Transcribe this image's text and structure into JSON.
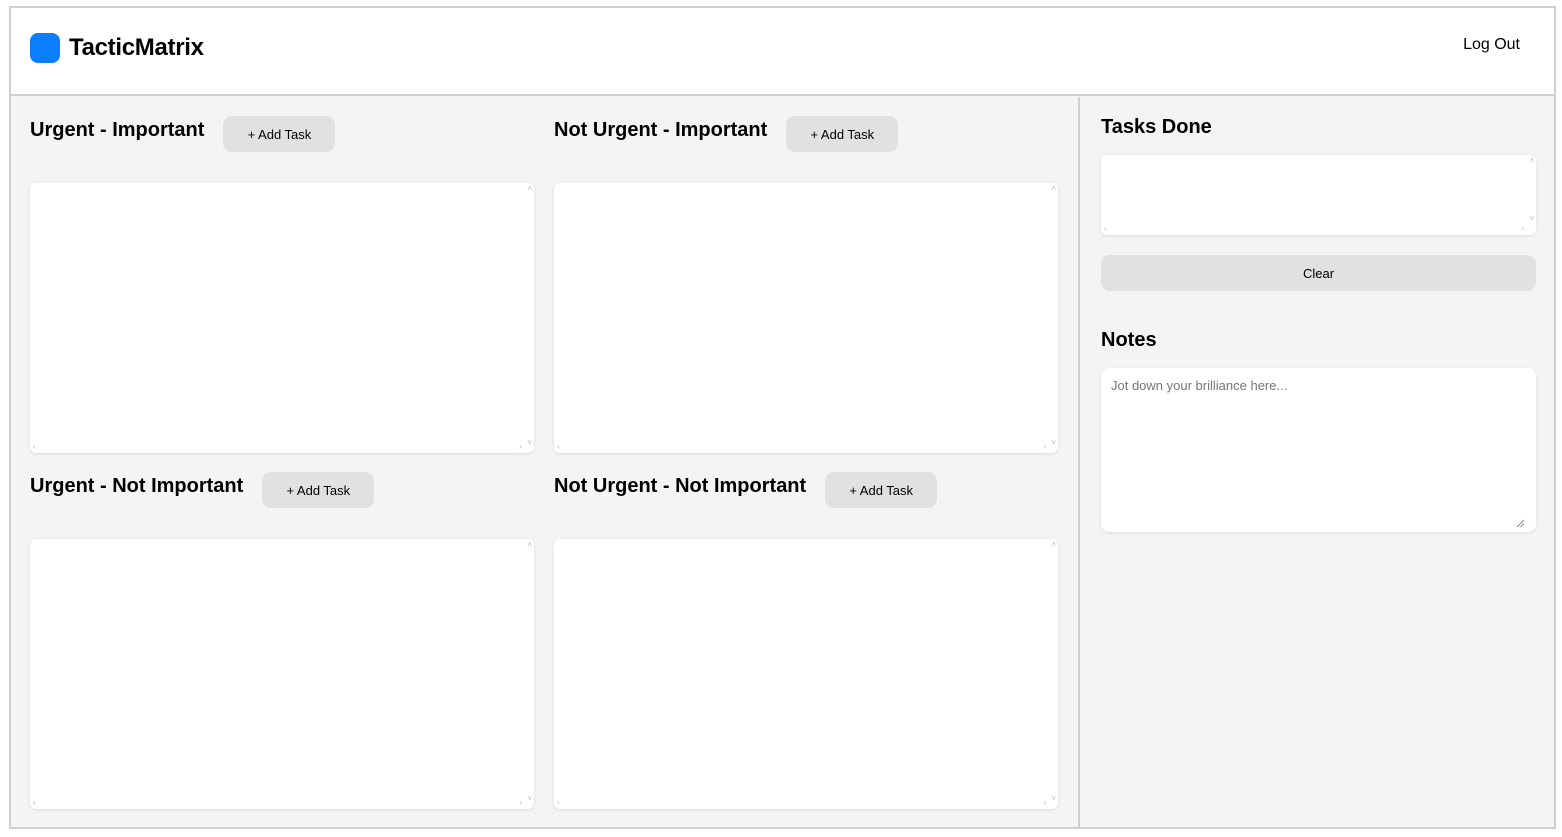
{
  "header": {
    "app_title": "TacticMatrix",
    "logout_label": "Log Out",
    "logo_color": "#0b7dff"
  },
  "quadrants": [
    {
      "title": "Urgent - Important",
      "add_label": "+ Add Task"
    },
    {
      "title": "Not Urgent - Important",
      "add_label": "+ Add Task"
    },
    {
      "title": "Urgent - Not Important",
      "add_label": "+ Add Task"
    },
    {
      "title": "Not Urgent - Not Important",
      "add_label": "+ Add Task"
    }
  ],
  "sidebar": {
    "tasks_done_title": "Tasks Done",
    "clear_label": "Clear",
    "notes_title": "Notes",
    "notes_placeholder": "Jot down your brilliance here..."
  }
}
